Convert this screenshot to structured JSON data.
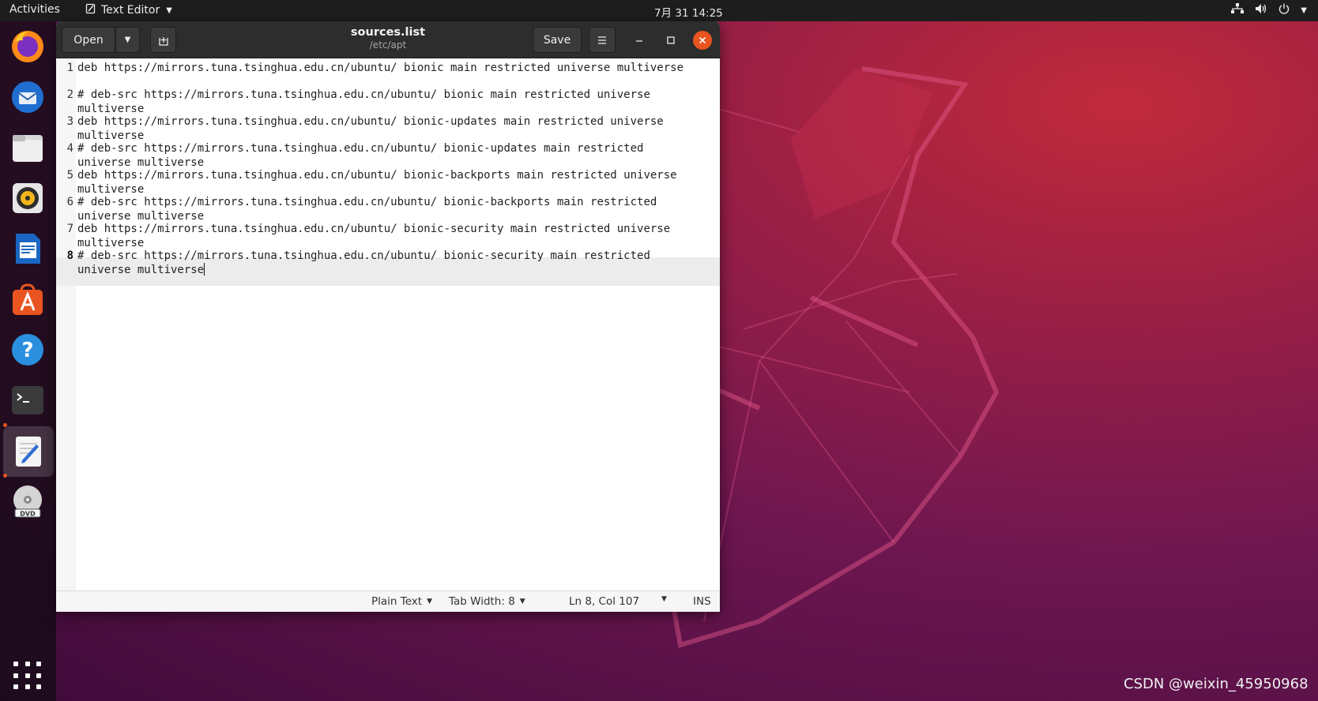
{
  "topbar": {
    "activities": "Activities",
    "app_name": "Text Editor",
    "clock": "7月 31  14:25"
  },
  "dock": {
    "apps": [
      "firefox",
      "thunderbird",
      "files",
      "rhythmbox",
      "libreoffice-writer",
      "ubuntu-software",
      "help",
      "terminal",
      "text-editor",
      "dvd"
    ],
    "active": "text-editor"
  },
  "window": {
    "title": "sources.list",
    "path": "/etc/apt",
    "open_label": "Open",
    "save_label": "Save"
  },
  "editor": {
    "lines": [
      {
        "num": "1",
        "text": "deb https://mirrors.tuna.tsinghua.edu.cn/ubuntu/ bionic main restricted universe multiverse"
      },
      {
        "num": "2",
        "text": "# deb-src https://mirrors.tuna.tsinghua.edu.cn/ubuntu/ bionic main restricted universe multiverse"
      },
      {
        "num": "3",
        "text": "deb https://mirrors.tuna.tsinghua.edu.cn/ubuntu/ bionic-updates main restricted universe multiverse"
      },
      {
        "num": "4",
        "text": "# deb-src https://mirrors.tuna.tsinghua.edu.cn/ubuntu/ bionic-updates main restricted universe multiverse"
      },
      {
        "num": "5",
        "text": "deb https://mirrors.tuna.tsinghua.edu.cn/ubuntu/ bionic-backports main restricted universe multiverse"
      },
      {
        "num": "6",
        "text": "# deb-src https://mirrors.tuna.tsinghua.edu.cn/ubuntu/ bionic-backports main restricted universe multiverse"
      },
      {
        "num": "7",
        "text": "deb https://mirrors.tuna.tsinghua.edu.cn/ubuntu/ bionic-security main restricted universe multiverse"
      },
      {
        "num": "8",
        "text": "# deb-src https://mirrors.tuna.tsinghua.edu.cn/ubuntu/ bionic-security main restricted universe multiverse"
      }
    ],
    "current_line": 8
  },
  "statusbar": {
    "language": "Plain Text",
    "tab_width": "Tab Width: 8",
    "position": "Ln 8, Col 107",
    "mode": "INS"
  },
  "watermark": "CSDN @weixin_45950968",
  "colors": {
    "accent": "#e95420",
    "topbar": "#1d1d1d",
    "headerbar": "#2d2d2d"
  }
}
